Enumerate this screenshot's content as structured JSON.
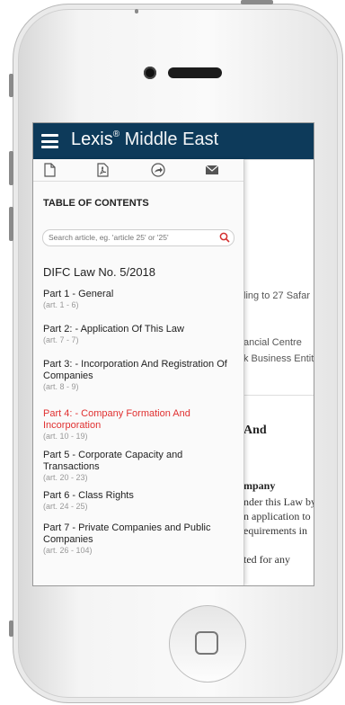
{
  "app": {
    "brand_name": "Lexis",
    "brand_mark": "®",
    "brand_suffix": " Middle East"
  },
  "toolbar": {
    "icons": [
      "document-icon",
      "pdf-icon",
      "share-icon",
      "mail-icon"
    ]
  },
  "toc": {
    "title": "TABLE OF CONTENTS",
    "search_placeholder": "Search article, eg. 'article 25' or '25'",
    "law_title": "DIFC Law No. 5/2018",
    "items": [
      {
        "title": "Part 1 - General",
        "articles": "(art. 1 - 6)"
      },
      {
        "title": "Part 2: - Application Of This Law",
        "articles": "(art. 7 - 7)"
      },
      {
        "title": "Part 3: - Incorporation And Registration Of Companies",
        "articles": "(art. 8 - 9)"
      },
      {
        "title": "Part 4: - Company Formation And Incorporation",
        "articles": "(art. 10 - 19)",
        "active": true
      },
      {
        "title": "Part 5 - Corporate Capacity and Transactions",
        "articles": "(art. 20 - 23)"
      },
      {
        "title": "Part 6 - Class Rights",
        "articles": "(art. 24 - 25)"
      },
      {
        "title": "Part 7 - Private Companies and Public Companies",
        "articles": "(art. 26 - 104)"
      }
    ]
  },
  "background": {
    "line1": "ling to 27 Safar",
    "line2": "ancial Centre",
    "line3": "k Business Entities",
    "heading": "And",
    "subheading": "mpany",
    "body1": "nder this Law by",
    "body2": "n application to",
    "body3": "equirements in",
    "body4": "ted for any"
  },
  "colors": {
    "appbar": "#0d3a5a",
    "active_item": "#e03030"
  }
}
